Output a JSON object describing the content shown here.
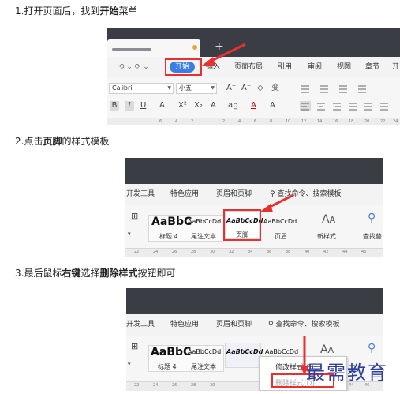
{
  "steps": [
    {
      "pre": "1.打开页面后，找到",
      "bold": "开始",
      "post": "菜单"
    },
    {
      "pre": "2.点击",
      "bold": "页脚",
      "post": "的样式模板"
    },
    {
      "pre": "3.最后鼠标",
      "bold": "右键",
      "mid": "选择",
      "bold2": "删除样式",
      "post": "按钮即可"
    }
  ],
  "shot1": {
    "tab_plus": "+",
    "quick_icons": "⟲ ⌄ ⟳ ⌄",
    "menu": [
      "开始",
      "插入",
      "页面布局",
      "引用",
      "审阅",
      "视图",
      "章节",
      "开"
    ],
    "font_name": "Calibri",
    "font_size": "小五",
    "tools_row1": [
      "A⁺",
      "A⁻",
      "◇",
      "变"
    ],
    "tools_row2": [
      "B",
      "I",
      "U",
      "A",
      "X²",
      "X₂",
      "A",
      "ab̲",
      "A",
      "A"
    ],
    "ruler_ticks": [
      "6",
      "4",
      "2",
      "2",
      "4",
      "6",
      "8",
      "10",
      "12",
      "14",
      "16",
      "18",
      "20",
      "22",
      "24"
    ]
  },
  "shot2": {
    "menu": [
      "开发工具",
      "特色应用",
      "页眉和页脚",
      "查找命令、搜索模板"
    ],
    "styles": [
      {
        "sample": "AaBbC",
        "name": "标题 4"
      },
      {
        "sample": "AaBbCcDd",
        "name": "尾注文本"
      },
      {
        "sample": "AaBbCcDd",
        "name": "页脚"
      },
      {
        "sample": "AaBbCcDd",
        "name": "页眉"
      }
    ],
    "new_style": "新样式",
    "find": "查找替",
    "ruler_ticks": [
      "22",
      "24",
      "26",
      "28",
      "30",
      "32",
      "34",
      "36",
      "38",
      "40",
      "42",
      "44",
      "46"
    ]
  },
  "shot3": {
    "menu": [
      "开发工具",
      "特色应用",
      "页眉和页脚",
      "查找命令、搜索模板"
    ],
    "styles": [
      {
        "sample": "AaBbC",
        "name": "标题 4"
      },
      {
        "sample": "AaBbCcDd",
        "name": "尾注文本"
      },
      {
        "sample": "AaBbCcDd",
        "name": ""
      },
      {
        "sample": "AaBbCcDd",
        "name": ""
      }
    ],
    "context_menu": [
      "修改样式(E)...",
      "删除样式(D)"
    ],
    "ruler_ticks": [
      "22",
      "24",
      "26",
      "28",
      "30",
      "44",
      "46"
    ],
    "watermark": "最需教育"
  },
  "colors": {
    "highlight": "#e8302e",
    "accent": "#3c7de3",
    "titlebar": "#3a3d44",
    "watermark": "#2c3f9c"
  }
}
